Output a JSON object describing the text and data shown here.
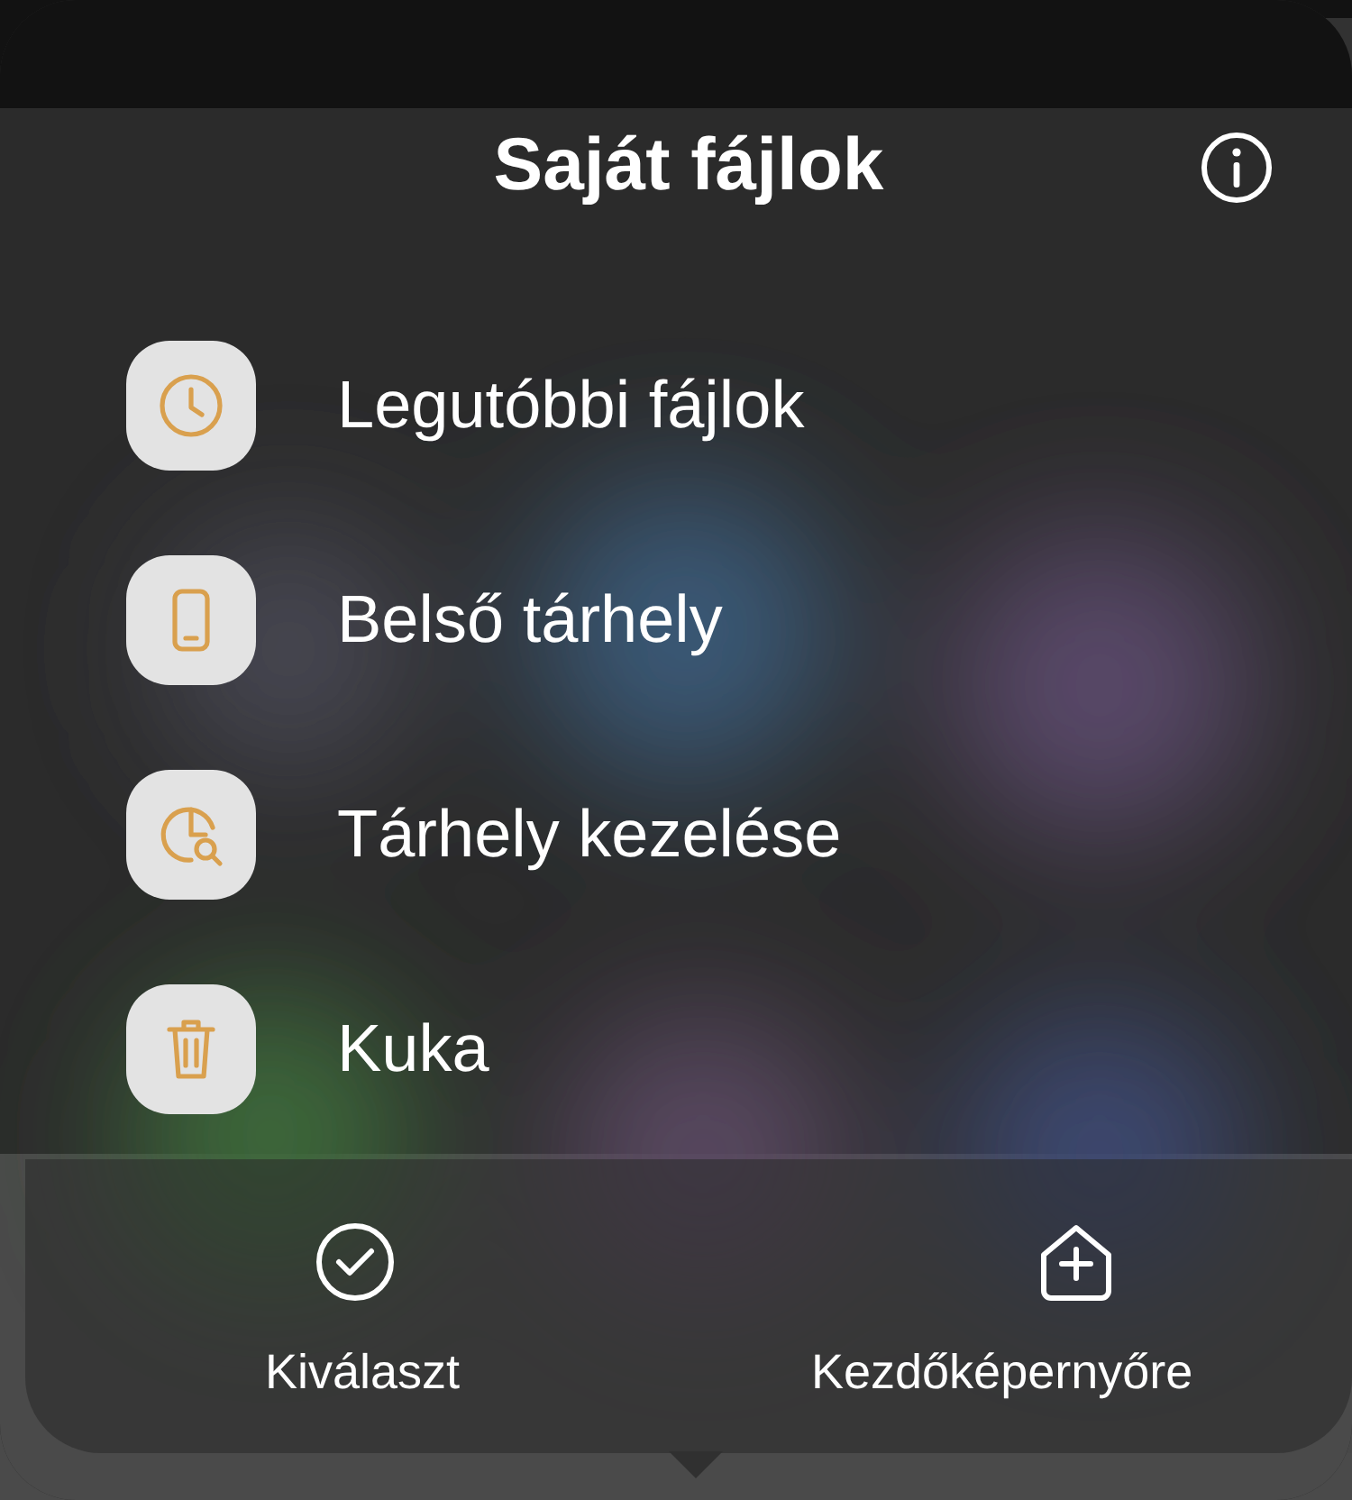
{
  "menu": {
    "title": "Saját fájlok",
    "items": [
      {
        "label": "Legutóbbi fájlok"
      },
      {
        "label": "Belső tárhely"
      },
      {
        "label": "Tárhely kezelése"
      },
      {
        "label": "Kuka"
      }
    ],
    "actions": [
      {
        "label": "Kiválaszt"
      },
      {
        "label": "Kezdőképernyőre"
      }
    ]
  }
}
